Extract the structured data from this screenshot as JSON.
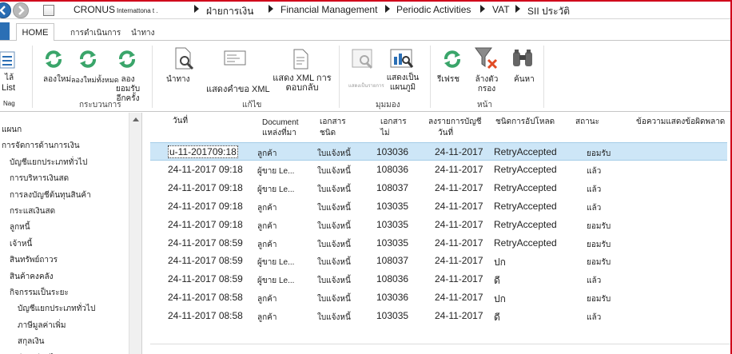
{
  "titlebar": {
    "company": "CRONUS",
    "company_sub": "Internattona t .",
    "crumbs": [
      "ฝ่ายการเงิน",
      "Financial Management",
      "Periodic Activities",
      "VAT",
      "SII ประวัติ"
    ]
  },
  "ribbon_tabs": {
    "home": "HOME",
    "actions": "การดำเนินการ",
    "navigate": "นำทาง"
  },
  "ribbon": {
    "left_partial": [
      "ไล้",
      "List",
      "Nag"
    ],
    "groups": [
      {
        "label": "กระบวนการ",
        "buttons": [
          "ลองใหม่",
          "ลองใหม่ทั้งหมด",
          "ลองยอมรับอีกครั้ง"
        ]
      },
      {
        "label": "แก้ไข",
        "buttons": [
          "นำทาง",
          "แสดงคำขอ XML",
          "แสดง XML การตอบกลับ"
        ]
      },
      {
        "label": "มุมมอง",
        "buttons": [
          "แสดงเป็นรายการ",
          "แสดงเป็นแผนภูมิ"
        ]
      },
      {
        "label": "หน้า",
        "buttons": [
          "รีเฟรช",
          "ล้างตัวกรอง",
          "ค้นหา"
        ]
      }
    ]
  },
  "leftnav": {
    "items": [
      {
        "label": "แผนก",
        "level": 0
      },
      {
        "label": "การจัดการด้านการเงิน",
        "level": 0
      },
      {
        "label": "บัญชีแยกประเภททั่วไป",
        "level": 1
      },
      {
        "label": "การบริหารเงินสด",
        "level": 1
      },
      {
        "label": "การลงบัญชีต้นทุนสินค้า",
        "level": 1
      },
      {
        "label": "กระแสเงินสด",
        "level": 1
      },
      {
        "label": "ลูกหนี้",
        "level": 1
      },
      {
        "label": "เจ้าหนี้",
        "level": 1
      },
      {
        "label": "สินทรัพย์ถาวร",
        "level": 1
      },
      {
        "label": "สินค้าคงคลัง",
        "level": 1
      },
      {
        "label": "กิจกรรมเป็นระยะ",
        "level": 1
      },
      {
        "label": "บัญชีแยกประเภททั่วไป",
        "level": 2
      },
      {
        "label": "ภาษีมูลค่าเพิ่ม",
        "level": 2
      },
      {
        "label": "สกุลเงิน",
        "level": 2
      },
      {
        "label": "ปีบัญชีถัดไป",
        "level": 2
      }
    ]
  },
  "table": {
    "headers": {
      "date": "วันที่",
      "document_source": [
        "Document",
        "แหล่งที่มา"
      ],
      "doc_type": [
        "เอกสาร",
        "ชนิด"
      ],
      "doc_no": [
        "เอกสาร",
        "ไม่"
      ],
      "posting_date": [
        "ลงรายการบัญชี",
        "วันที่"
      ],
      "upload_type": "ชนิดการอัปโหลด",
      "status": "สถานะ",
      "error": "ข้อความแสดงข้อผิดพลาด"
    },
    "rows": [
      {
        "date": "u-11-201709:18",
        "source": "ลูกค้า",
        "type": "ใบแจ้งหนี้",
        "no": "103036",
        "posting": "24-11-2017",
        "upload": "RetryAccepted",
        "status": "ยอมรับ",
        "selected": true
      },
      {
        "date": "24-11-2017 09:18",
        "source": "ผู้ขาย Le...",
        "type": "ใบแจ้งหนี้",
        "no": "108036",
        "posting": "24-11-2017",
        "upload": "RetryAccepted",
        "status": "แล้ว",
        "selected": false
      },
      {
        "date": "24-11-2017 09:18",
        "source": "ผู้ขาย Le...",
        "type": "ใบแจ้งหนี้",
        "no": "108037",
        "posting": "24-11-2017",
        "upload": "RetryAccepted",
        "status": "แล้ว",
        "selected": false
      },
      {
        "date": "24-11-2017 09:18",
        "source": "ลูกค้า",
        "type": "ใบแจ้งหนี้",
        "no": "103035",
        "posting": "24-11-2017",
        "upload": "RetryAccepted",
        "status": "แล้ว",
        "selected": false
      },
      {
        "date": "24-11-2017 09:18",
        "source": "ลูกค้า",
        "type": "ใบแจ้งหนี้",
        "no": "103035",
        "posting": "24-11-2017",
        "upload": "RetryAccepted",
        "status": "ยอมรับ",
        "selected": false
      },
      {
        "date": "24-11-2017 08:59",
        "source": "ลูกค้า",
        "type": "ใบแจ้งหนี้",
        "no": "103035",
        "posting": "24-11-2017",
        "upload": "RetryAccepted",
        "status": "ยอมรับ",
        "selected": false
      },
      {
        "date": "24-11-2017 08:59",
        "source": "ผู้ขาย Le...",
        "type": "ใบแจ้งหนี้",
        "no": "108037",
        "posting": "24-11-2017",
        "upload": "ปก",
        "status": "ยอมรับ",
        "selected": false
      },
      {
        "date": "24-11-2017 08:59",
        "source": "ผู้ขาย Le...",
        "type": "ใบแจ้งหนี้",
        "no": "108036",
        "posting": "24-11-2017",
        "upload": "ดี",
        "status": "แล้ว",
        "selected": false
      },
      {
        "date": "24-11-2017 08:58",
        "source": "ลูกค้า",
        "type": "ใบแจ้งหนี้",
        "no": "103036",
        "posting": "24-11-2017",
        "upload": "ปก",
        "status": "ยอมรับ",
        "selected": false
      },
      {
        "date": "24-11-2017 08:58",
        "source": "ลูกค้า",
        "type": "ใบแจ้งหนี้",
        "no": "103035",
        "posting": "24-11-2017",
        "upload": "ดี",
        "status": "แล้ว",
        "selected": false
      }
    ]
  },
  "colors": {
    "accent_blue": "#2b6fb5",
    "refresh_green": "#3aa56a",
    "selected_row": "#cde6f7",
    "frame_red": "#d0021b"
  }
}
